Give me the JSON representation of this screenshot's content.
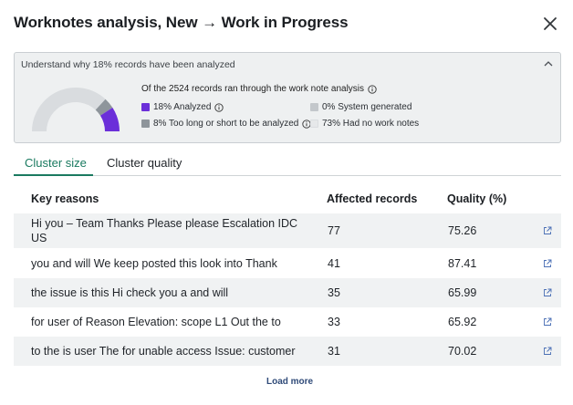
{
  "modal": {
    "title": "Worknotes analysis, New → Work in Progress"
  },
  "panel": {
    "header": "Understand why 18% records have been analyzed",
    "summary": "Of the 2524 records ran through the work note analysis",
    "gauge": {
      "segments": [
        {
          "label": "Analyzed",
          "percent": 18,
          "color": "#6b2fd9"
        },
        {
          "label": "Too long or short to be analyzed",
          "percent": 8,
          "color": "#8e959b"
        },
        {
          "label": "System generated",
          "percent": 0,
          "color": "#c3c7cb"
        },
        {
          "label": "Had no work notes",
          "percent": 73,
          "color": "#d9dcdf"
        }
      ]
    },
    "legend": {
      "analyzed": "18% Analyzed",
      "too_long": "8% Too long or short to be analyzed",
      "system": "0% System generated",
      "no_notes": "73% Had no work notes"
    },
    "colors": {
      "analyzed": "#6b2fd9",
      "too_long": "#8e959b",
      "system": "#c3c7cb",
      "no_notes": "#e6e8ea"
    }
  },
  "tabs": [
    {
      "label": "Cluster size",
      "active": true
    },
    {
      "label": "Cluster quality",
      "active": false
    }
  ],
  "table": {
    "headers": [
      "Key reasons",
      "Affected records",
      "Quality (%)"
    ],
    "rows": [
      {
        "reason": "Hi you – Team Thanks Please please Escalation IDC US",
        "records": "77",
        "quality": "75.26"
      },
      {
        "reason": "you and will We keep posted this look into Thank",
        "records": "41",
        "quality": "87.41"
      },
      {
        "reason": "the issue is this Hi check you a and will",
        "records": "35",
        "quality": "65.99"
      },
      {
        "reason": "for user of Reason Elevation: scope L1 Out the to",
        "records": "33",
        "quality": "65.92"
      },
      {
        "reason": "to the is user The for unable access Issue: customer",
        "records": "31",
        "quality": "70.02"
      }
    ]
  },
  "footer": {
    "load_more": "Load more"
  },
  "accent": "#1a7a60"
}
